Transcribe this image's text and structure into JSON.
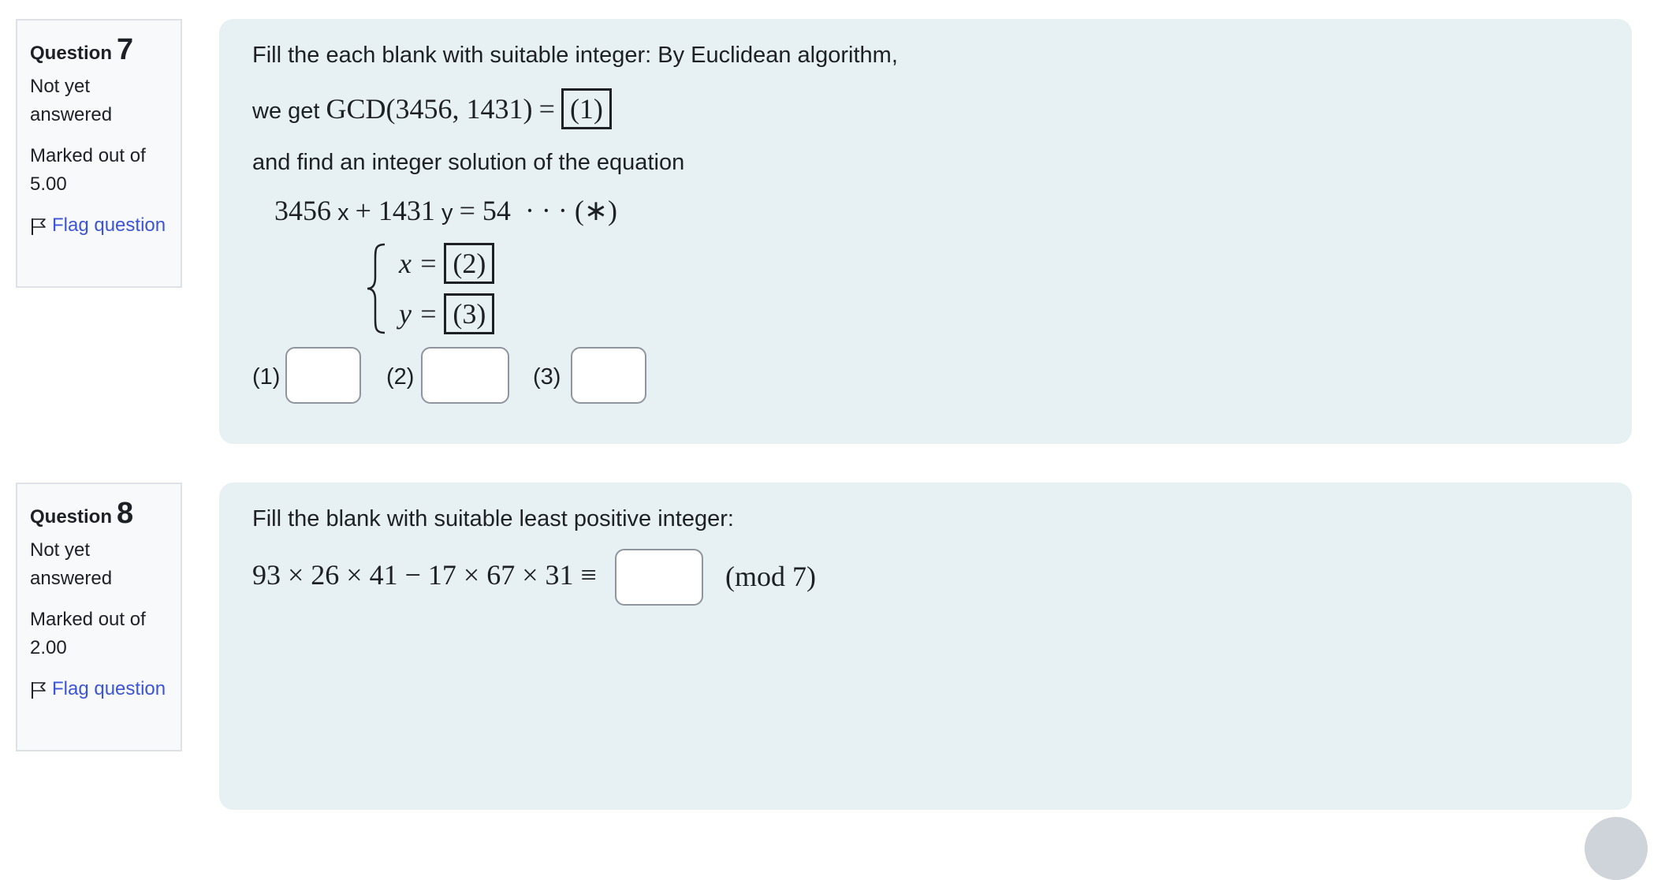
{
  "questions": [
    {
      "label": "Question",
      "number": "7",
      "status": "Not yet answered",
      "marks": "Marked out of 5.00",
      "flag": "Flag question",
      "lines": {
        "intro": "Fill the each blank with suitable integer:  By Euclidean algorithm,",
        "we_get": "we get",
        "gcd": "GCD(3456, 1431)",
        "equals": "=",
        "box1": "(1)",
        "find": "and find an integer solution of the equation",
        "eq_coef1": "3456",
        "eq_x": "x",
        "eq_plus": "+ 1431",
        "eq_y": "y",
        "eq_rhs": "= 54",
        "eq_dots": "· · · (∗)",
        "sys_x": "x =",
        "box2": "(2)",
        "sys_y": "y =",
        "box3": "(3)"
      },
      "answers": [
        {
          "label": "(1)",
          "value": ""
        },
        {
          "label": "(2)",
          "value": ""
        },
        {
          "label": "(3)",
          "value": ""
        }
      ]
    },
    {
      "label": "Question",
      "number": "8",
      "status": "Not yet answered",
      "marks": "Marked out of 2.00",
      "flag": "Flag question",
      "lines": {
        "intro": "Fill the blank with suitable least positive integer:",
        "expr": "93 × 26 × 41 − 17 × 67 × 31 ≡",
        "mod": "(mod 7)"
      },
      "answers": [
        {
          "label": "",
          "value": ""
        }
      ]
    }
  ],
  "colors": {
    "accent": "#3c55d6",
    "content_bg": "#e7f0f3",
    "info_bg": "#f8f9fa"
  }
}
